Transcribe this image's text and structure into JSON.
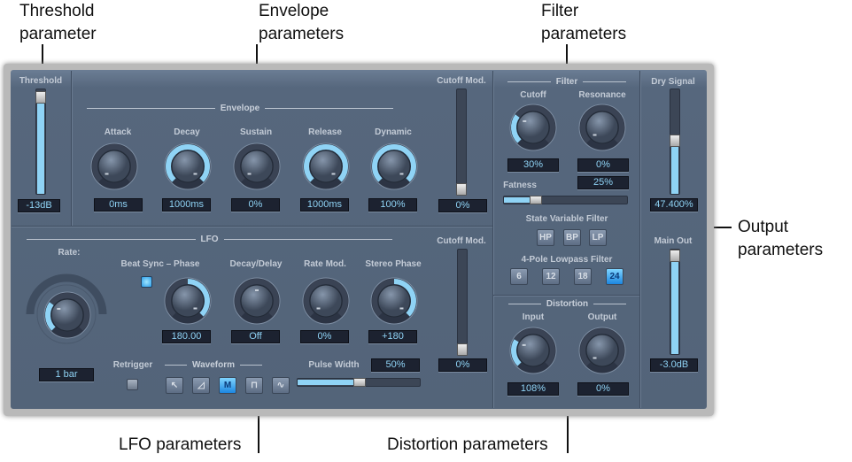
{
  "callouts": {
    "threshold": [
      "Threshold",
      "parameter"
    ],
    "envelope": [
      "Envelope",
      "parameters"
    ],
    "filter": [
      "Filter",
      "parameters"
    ],
    "output": [
      "Output",
      "parameters"
    ],
    "lfo": "LFO parameters",
    "distortion": "Distortion parameters"
  },
  "threshold": {
    "label": "Threshold",
    "value": "-13dB",
    "level": 0.88
  },
  "envelope": {
    "heading": "Envelope",
    "attack": {
      "label": "Attack",
      "value": "0ms",
      "fraction": 0,
      "origin": 0
    },
    "decay": {
      "label": "Decay",
      "value": "1000ms",
      "fraction": 1,
      "origin": 0
    },
    "sustain": {
      "label": "Sustain",
      "value": "0%",
      "fraction": 0,
      "origin": 0
    },
    "release": {
      "label": "Release",
      "value": "1000ms",
      "fraction": 1,
      "origin": 0
    },
    "dynamic": {
      "label": "Dynamic",
      "value": "100%",
      "fraction": 1,
      "origin": 0
    },
    "cutoff_mod": {
      "label": "Cutoff Mod.",
      "value": "0%",
      "level": 0
    }
  },
  "lfo": {
    "heading": "LFO",
    "rate": {
      "label": "Rate:",
      "value": "1 bar",
      "fraction": 0.3,
      "origin": 0
    },
    "beat_sync_label": "Beat Sync – Phase",
    "phase": {
      "value": "180.00",
      "fraction": 1,
      "origin": 0.5
    },
    "decay_delay": {
      "label": "Decay/Delay",
      "value": "Off",
      "fraction": 0.5,
      "origin": 0.5
    },
    "rate_mod": {
      "label": "Rate Mod.",
      "value": "0%",
      "fraction": 0,
      "origin": 0
    },
    "stereo_phase": {
      "label": "Stereo Phase",
      "value": "+180",
      "fraction": 1,
      "origin": 0.5
    },
    "retrigger": "Retrigger",
    "waveform": {
      "label": "Waveform",
      "buttons": [
        "↖",
        "◿",
        "M",
        "⊓",
        "∿"
      ],
      "selected": 2
    },
    "pulse_width": {
      "label": "Pulse Width",
      "value": "50%",
      "level": 0.5
    },
    "cutoff_mod": {
      "label": "Cutoff Mod.",
      "value": "0%",
      "level": 0
    }
  },
  "filter": {
    "heading": "Filter",
    "cutoff": {
      "label": "Cutoff",
      "value": "30%",
      "fraction": 0.3,
      "origin": 0
    },
    "resonance": {
      "label": "Resonance",
      "value": "0%",
      "fraction": 0,
      "origin": 0
    },
    "fatness": {
      "label": "Fatness",
      "value": "25%",
      "level": 0.25
    },
    "svf": {
      "label": "State Variable Filter",
      "buttons": [
        "HP",
        "BP",
        "LP"
      ]
    },
    "pole": {
      "label": "4-Pole Lowpass Filter",
      "buttons": [
        "6",
        "12",
        "18",
        "24"
      ],
      "selected": 3
    }
  },
  "distortion": {
    "heading": "Distortion",
    "input": {
      "label": "Input",
      "value": "108%",
      "fraction": 0.28,
      "origin": 0
    },
    "output": {
      "label": "Output",
      "value": "0%",
      "fraction": 0,
      "origin": 0
    }
  },
  "output": {
    "dry": {
      "label": "Dry Signal",
      "value": "47.400%",
      "level": 0.47
    },
    "main": {
      "label": "Main Out",
      "value": "-3.0dB",
      "level": 0.93
    }
  },
  "colors": {
    "panel": "#56677d",
    "accent": "#8fd3f5"
  }
}
